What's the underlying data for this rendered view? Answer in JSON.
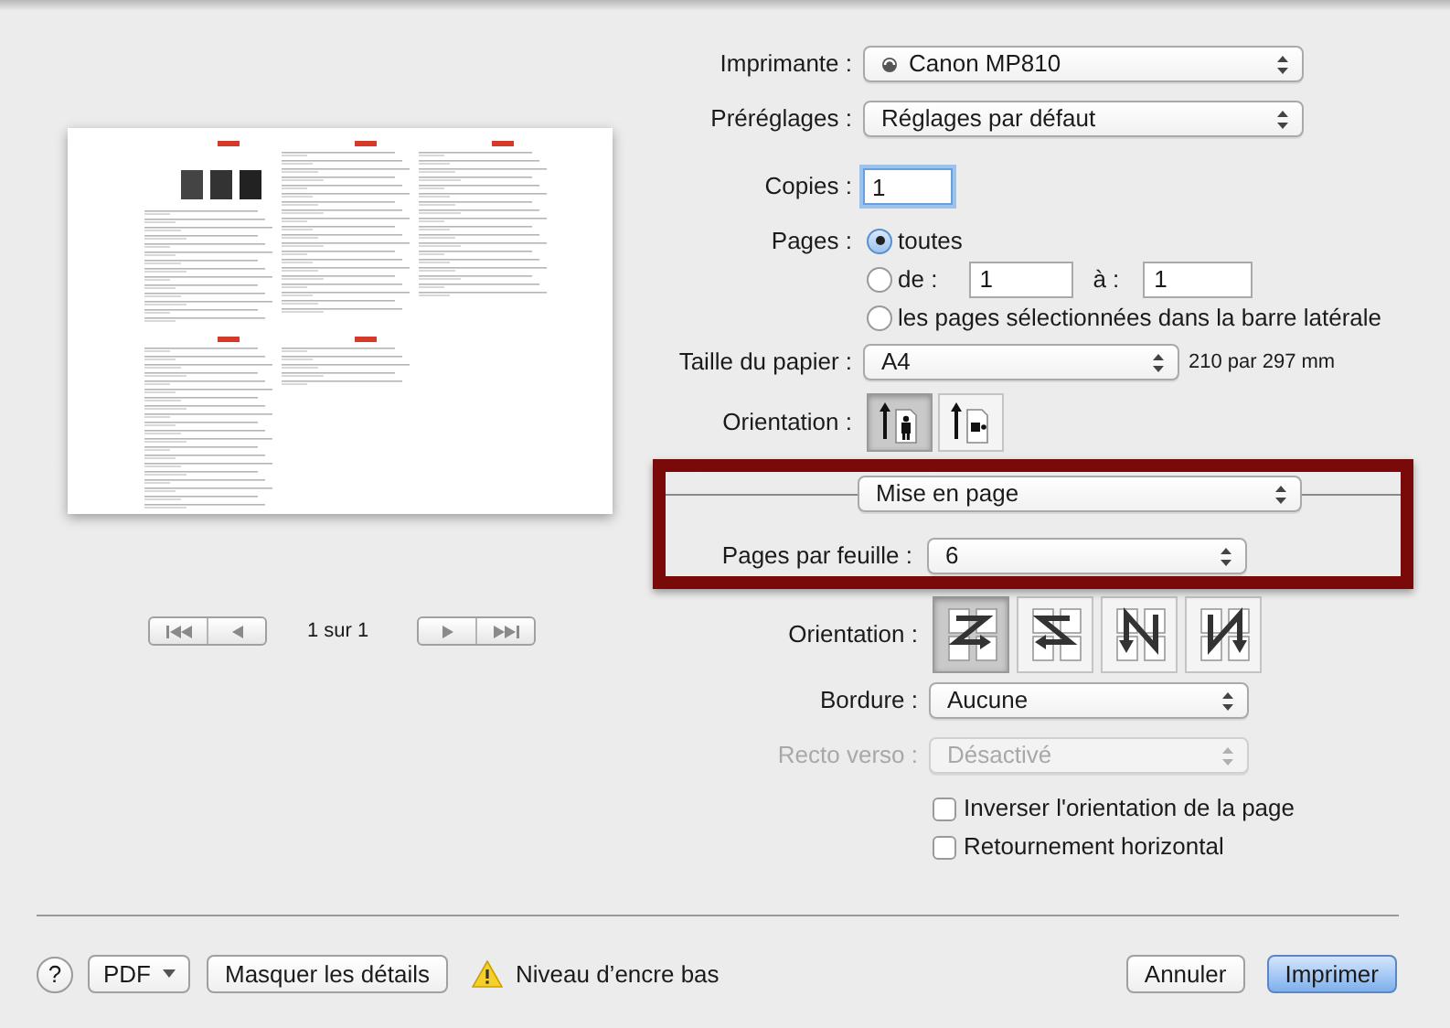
{
  "preview": {
    "page_indicator": "1 sur 1"
  },
  "printer": {
    "label": "Imprimante :",
    "value": "Canon MP810"
  },
  "presets": {
    "label": "Préréglages :",
    "value": "Réglages par défaut"
  },
  "copies": {
    "label": "Copies :",
    "value": "1"
  },
  "pages": {
    "label": "Pages :",
    "options": [
      {
        "kind": "all",
        "label": "toutes",
        "selected": true
      },
      {
        "kind": "range",
        "label": "de :",
        "selected": false,
        "from": "1",
        "to_label": "à :",
        "to": "1"
      },
      {
        "kind": "sidebar",
        "label": "les pages sélectionnées dans la barre latérale",
        "selected": false
      }
    ]
  },
  "paper_size": {
    "label": "Taille du papier :",
    "value": "A4",
    "dimensions": "210 par 297 mm"
  },
  "orientation": {
    "label": "Orientation :",
    "options": [
      {
        "kind": "portrait",
        "selected": true
      },
      {
        "kind": "landscape",
        "selected": false
      }
    ]
  },
  "section_popup": {
    "value": "Mise en page"
  },
  "layout": {
    "pages_per_sheet": {
      "label": "Pages par feuille :",
      "value": "6"
    },
    "direction": {
      "label": "Orientation :",
      "options": [
        {
          "kind": "z",
          "selected": true
        },
        {
          "kind": "s",
          "selected": false
        },
        {
          "kind": "n_reverse",
          "selected": false
        },
        {
          "kind": "n",
          "selected": false
        }
      ]
    },
    "border": {
      "label": "Bordure :",
      "value": "Aucune",
      "disabled": false
    },
    "two_sided": {
      "label": "Recto verso :",
      "value": "Désactivé",
      "disabled": true
    },
    "checkboxes": [
      {
        "label": "Inverser l'orientation de la page",
        "checked": false
      },
      {
        "label": "Retournement horizontal",
        "checked": false
      }
    ]
  },
  "footer": {
    "help": "?",
    "pdf": "PDF",
    "details_button": "Masquer les détails",
    "warning": "Niveau d’encre bas",
    "buttons": [
      {
        "kind": "cancel",
        "label": "Annuler"
      },
      {
        "kind": "default",
        "label": "Imprimer"
      }
    ]
  }
}
